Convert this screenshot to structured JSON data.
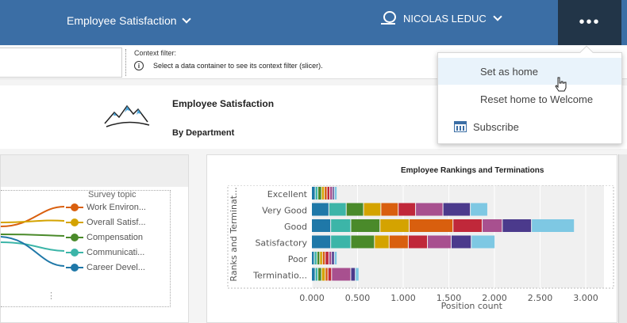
{
  "topbar": {
    "title": "Employee Satisfaction",
    "user": "NICOLAS LEDUC",
    "more": "•••"
  },
  "filterbar": {
    "label": "Context filter:",
    "message": "Select a data container to see its context filter (slicer).",
    "info_icon": "i"
  },
  "header": {
    "title": "Employee Satisfaction",
    "subtitle": "By Department"
  },
  "menu": {
    "items": [
      {
        "label": "Set as home"
      },
      {
        "label": "Reset home to Welcome"
      },
      {
        "label": "Subscribe"
      }
    ]
  },
  "left_card": {
    "legend_title": "Survey topic",
    "legend": [
      {
        "name": "Work Environ...",
        "color": "#d95f0e"
      },
      {
        "name": "Overall Satisf...",
        "color": "#d4a300"
      },
      {
        "name": "Compensation",
        "color": "#4a8a2a"
      },
      {
        "name": "Communicati...",
        "color": "#3cb5a8"
      },
      {
        "name": "Career Devel...",
        "color": "#1f78a8"
      }
    ],
    "ellipsis": "⋮"
  },
  "chart_data": {
    "type": "bar",
    "orientation": "horizontal",
    "stacked": true,
    "title": "Employee Rankings and Terminations",
    "xlabel": "Position count",
    "ylabel": "Ranks and Terminat...",
    "categories": [
      "Excellent",
      "Very Good",
      "Good",
      "Satisfactory",
      "Poor",
      "Terminatio..."
    ],
    "xticks": [
      "0.000",
      "0.500",
      "1.000",
      "1.500",
      "2.000",
      "2.500",
      "3.000"
    ],
    "xlim": [
      0,
      3.2
    ],
    "colors": [
      "#1f78a8",
      "#3cb5a8",
      "#4a8a2a",
      "#d4a300",
      "#d95f0e",
      "#c0283a",
      "#a8508f",
      "#4b3a8c",
      "#7ec8e3"
    ],
    "segments": [
      [
        0.04,
        0.03,
        0.04,
        0.03,
        0.03,
        0.03,
        0.03,
        0.02,
        0.03
      ],
      [
        0.19,
        0.19,
        0.19,
        0.19,
        0.19,
        0.19,
        0.3,
        0.3,
        0.19
      ],
      [
        0.21,
        0.22,
        0.32,
        0.32,
        0.48,
        0.32,
        0.22,
        0.32,
        0.47
      ],
      [
        0.21,
        0.22,
        0.26,
        0.16,
        0.21,
        0.21,
        0.26,
        0.22,
        0.26
      ],
      [
        0.03,
        0.03,
        0.03,
        0.03,
        0.03,
        0.04,
        0.03,
        0.03,
        0.03
      ],
      [
        0.04,
        0.03,
        0.04,
        0.04,
        0.03,
        0.04,
        0.21,
        0.05,
        0.04
      ]
    ]
  }
}
